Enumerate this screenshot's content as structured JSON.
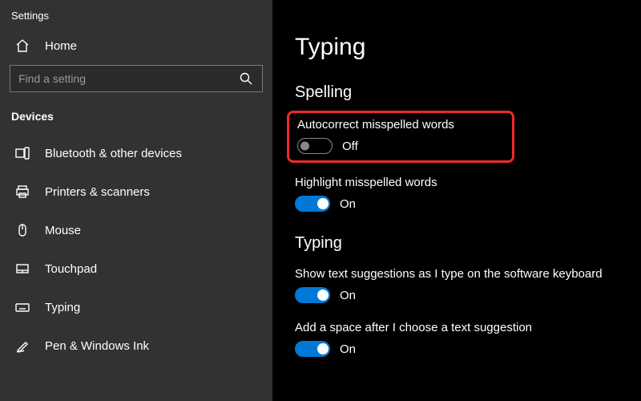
{
  "sidebar": {
    "title": "Settings",
    "home_label": "Home",
    "search_placeholder": "Find a setting",
    "category": "Devices",
    "items": [
      {
        "label": "Bluetooth & other devices"
      },
      {
        "label": "Printers & scanners"
      },
      {
        "label": "Mouse"
      },
      {
        "label": "Touchpad"
      },
      {
        "label": "Typing"
      },
      {
        "label": "Pen & Windows Ink"
      }
    ]
  },
  "main": {
    "page_title": "Typing",
    "sections": [
      {
        "title": "Spelling",
        "settings": [
          {
            "label": "Autocorrect misspelled words",
            "state": "Off",
            "on": false,
            "highlighted": true
          },
          {
            "label": "Highlight misspelled words",
            "state": "On",
            "on": true
          }
        ]
      },
      {
        "title": "Typing",
        "settings": [
          {
            "label": "Show text suggestions as I type on the software keyboard",
            "state": "On",
            "on": true
          },
          {
            "label": "Add a space after I choose a text suggestion",
            "state": "On",
            "on": true
          }
        ]
      }
    ]
  },
  "annotation": {
    "arrow_color": "#ee2a2a"
  }
}
